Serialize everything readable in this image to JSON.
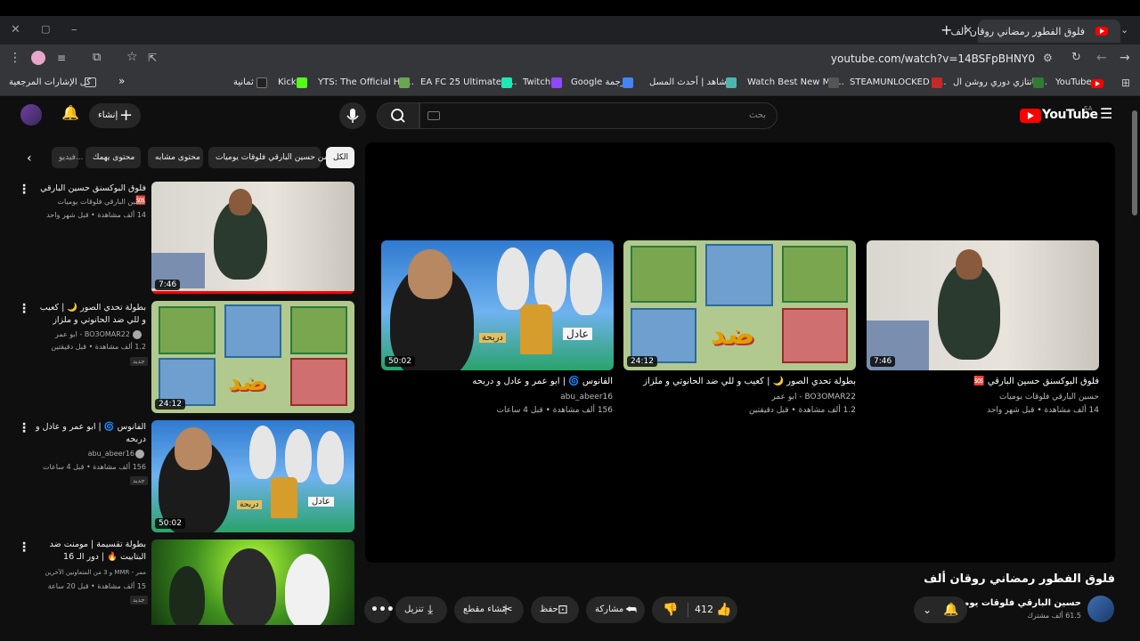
{
  "browser": {
    "tab_title": "فلوق الفطور رمضاني روقان ألف",
    "new_tab": "+",
    "url": "youtube.com/watch?v=14BSFpBHNY0",
    "bookmarks": [
      {
        "label": "YouTube",
        "color": "#ff0000"
      },
      {
        "label": "فانتازي دوري روشن ال...",
        "color": "#2e7d32"
      },
      {
        "label": "STEAMUNLOCKED »...",
        "color": "#c62828"
      },
      {
        "label": "Watch Best New Mo...",
        "color": "#555555"
      },
      {
        "label": "شاهد | أحدث المسل...",
        "color": "#4db6ac"
      },
      {
        "label": "Google ترجمة",
        "color": "#4285f4"
      },
      {
        "label": "Twitch",
        "color": "#9146ff"
      },
      {
        "label": "EA FC 25 Ultimate T...",
        "color": "#1de9b6"
      },
      {
        "label": "YTS: The Official Ho...",
        "color": "#6aa84f"
      },
      {
        "label": "Kick",
        "color": "#53fc18"
      },
      {
        "label": "ثمانية",
        "color": "#222222"
      }
    ],
    "all_bookmarks": "كل الإشارات المرجعية",
    "more_bookmarks": "»"
  },
  "youtube": {
    "logo": "YouTube",
    "logo_region": "SA",
    "search_placeholder": "بحث",
    "create_label": "إنشاء",
    "chips": [
      "الكل",
      "من حسين البارقي فلوقات يوميات",
      "محتوى مشابه",
      "محتوى يهمك",
      "فيديو..."
    ],
    "sidebar": [
      {
        "title": "فلوق البوكسنق حسين البارقي 🆘",
        "channel": "حسين البارقي فلوقات يوميات",
        "meta": "14 ألف مشاهدة • قبل شهر واحد",
        "badge": "",
        "duration": "7:46"
      },
      {
        "title": "بطولة تحدي الصور 🌙 | كعيب و للي ضد الحانوتي و ملزاز",
        "channel": "BO3OMAR22 - ابو عمر",
        "meta": "1.2 ألف مشاهدة • قبل دقيقتين",
        "badge": "جديد",
        "duration": "24:12"
      },
      {
        "title": "الفانوس 🌀 | ابو عمر و عادل و دربحه",
        "channel": "abu_abeer16",
        "meta": "156 ألف مشاهدة • قبل 4 ساعات",
        "badge": "جديد",
        "duration": "50:02"
      },
      {
        "title": "بطولة تقسيمة | مومنت ضد البتابيت 🔥 | دور الـ 16",
        "channel": "ممر - MMR و 3 من المتعاونين الآخرين",
        "meta": "15 ألف مشاهدة • قبل 20 ساعة",
        "badge": "جديد",
        "duration": ""
      }
    ],
    "endscreen": [
      {
        "title": "فلوق البوكسنق حسين البارقي 🆘",
        "channel": "حسين البارقي فلوقات يوميات",
        "meta": "14 ألف مشاهدة • قبل شهر واحد",
        "duration": "7:46"
      },
      {
        "title": "بطولة تحدي الصور 🌙 | كعيب و للي ضد الحانوتي و ملزاز",
        "channel": "BO3OMAR22 - ابو عمر",
        "meta": "1.2 ألف مشاهدة • قبل دقيقتين",
        "duration": "24:12"
      },
      {
        "title": "الفانوس 🌀 | ابو عمر و عادل و دربحه",
        "channel": "abu_abeer16",
        "meta": "156 ألف مشاهدة • قبل 4 ساعات",
        "duration": "50:02"
      }
    ],
    "video_title": "فلوق الفطور رمضاني روقان ألف",
    "channel_name": "حسين البارقي فلوقات يوميات",
    "subscribers": "61.5 ألف مشترك",
    "likes": "412",
    "share_label": "مشاركة",
    "save_label": "حفظ",
    "clip_label": "إنشاء مقطع",
    "download_label": "تنزيل",
    "thumb_text": {
      "dhad": "ضد",
      "adel": "عادل",
      "dirbaha": "دربحة"
    }
  }
}
